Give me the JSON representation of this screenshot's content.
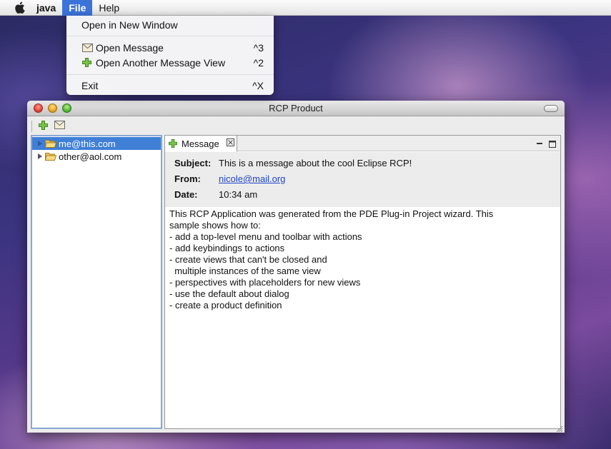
{
  "menubar": {
    "app_name": "java",
    "menus": [
      "File",
      "Help"
    ]
  },
  "file_menu": {
    "items": [
      {
        "label": "Open in New Window",
        "shortcut": "",
        "icon": ""
      },
      {
        "label": "Open Message",
        "shortcut": "^3",
        "icon": "envelope-icon"
      },
      {
        "label": "Open Another Message View",
        "shortcut": "^2",
        "icon": "green-plus-icon"
      },
      {
        "label": "Exit",
        "shortcut": "^X",
        "icon": ""
      }
    ]
  },
  "window": {
    "title": "RCP Product"
  },
  "tree": {
    "items": [
      {
        "label": "me@this.com",
        "selected": true
      },
      {
        "label": "other@aol.com",
        "selected": false
      }
    ]
  },
  "view": {
    "tab_label": "Message",
    "subject_label": "Subject:",
    "subject_value": "This is a message about the cool Eclipse RCP!",
    "from_label": "From:",
    "from_value": "nicole@mail.org",
    "date_label": "Date:",
    "date_value": "10:34 am",
    "body": "This RCP Application was generated from the PDE Plug-in Project wizard. This\nsample shows how to:\n- add a top-level menu and toolbar with actions\n- add keybindings to actions\n- create views that can't be closed and\n  multiple instances of the same view\n- perspectives with placeholders for new views\n- use the default about dialog\n- create a product definition"
  },
  "colors": {
    "menu_highlight": "#3c73d8",
    "selection": "#3f7fd6",
    "link": "#1d44c8"
  }
}
